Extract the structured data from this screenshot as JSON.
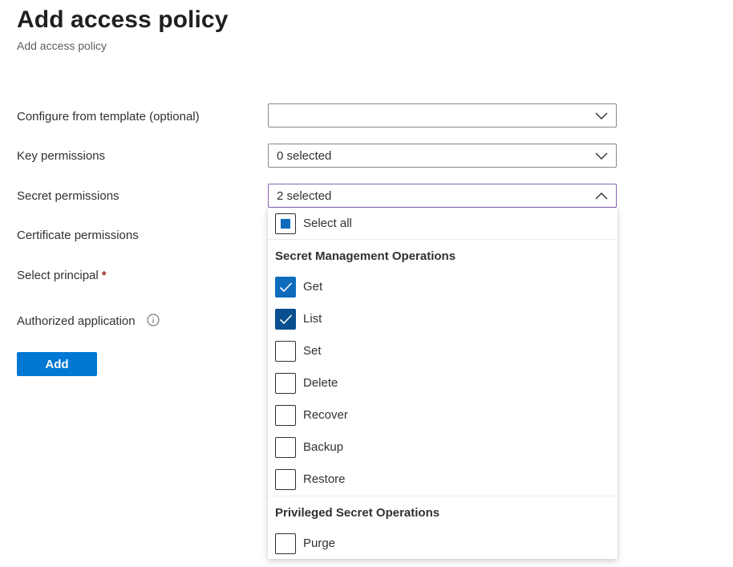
{
  "page": {
    "title": "Add access policy",
    "subtitle": "Add access policy"
  },
  "form": {
    "template": {
      "label": "Configure from template (optional)",
      "value": ""
    },
    "key_permissions": {
      "label": "Key permissions",
      "value": "0 selected"
    },
    "secret_permissions": {
      "label": "Secret permissions",
      "value": "2 selected"
    },
    "certificate_permissions": {
      "label": "Certificate permissions"
    },
    "select_principal": {
      "label": "Select principal",
      "required_mark": "*"
    },
    "authorized_application": {
      "label": "Authorized application",
      "icon": "info-icon"
    },
    "add_button": "Add"
  },
  "dropdown": {
    "select_all": {
      "label": "Select all",
      "state": "indeterminate"
    },
    "groups": [
      {
        "title": "Secret Management Operations",
        "options": [
          {
            "label": "Get",
            "checked": true
          },
          {
            "label": "List",
            "checked": true
          },
          {
            "label": "Set",
            "checked": false
          },
          {
            "label": "Delete",
            "checked": false
          },
          {
            "label": "Recover",
            "checked": false
          },
          {
            "label": "Backup",
            "checked": false
          },
          {
            "label": "Restore",
            "checked": false
          }
        ]
      },
      {
        "title": "Privileged Secret Operations",
        "options": [
          {
            "label": "Purge",
            "checked": false
          }
        ]
      }
    ]
  },
  "colors": {
    "accent": "#0078d4",
    "checkbox_checked": "#0f6cbd",
    "focus_border": "#8764b8",
    "required": "#a4262c"
  }
}
